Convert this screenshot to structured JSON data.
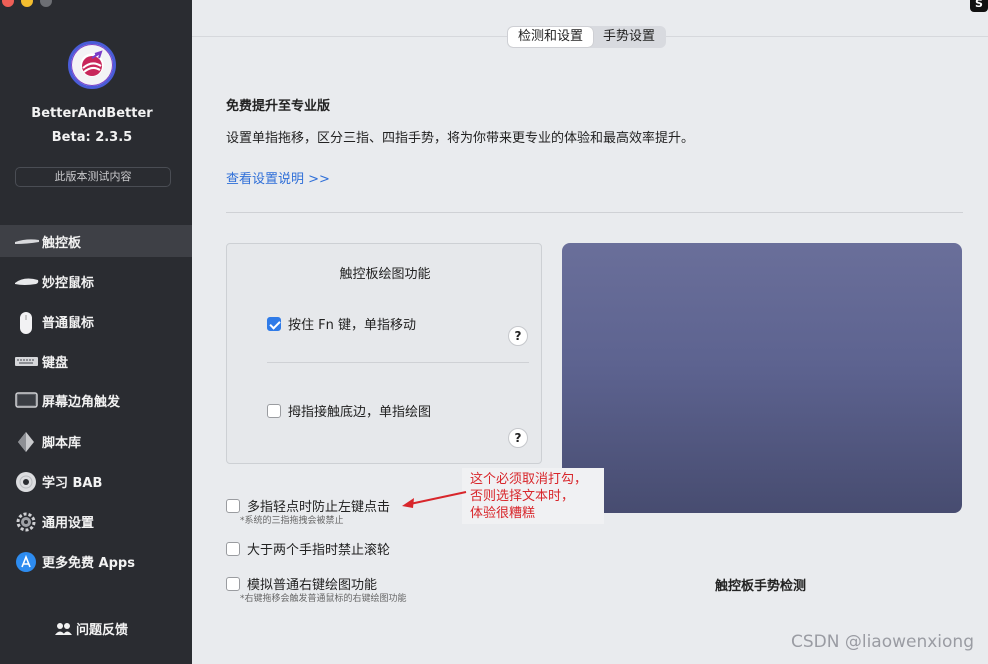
{
  "sidebar": {
    "app_name": "BetterAndBetter",
    "version": "Beta: 2.3.5",
    "test_button": "此版本测试内容",
    "items": [
      {
        "label": "触控板",
        "icon": "trackpad-icon",
        "active": true
      },
      {
        "label": "妙控鼠标",
        "icon": "magic-mouse-icon"
      },
      {
        "label": "普通鼠标",
        "icon": "mouse-icon"
      },
      {
        "label": "键盘",
        "icon": "keyboard-icon"
      },
      {
        "label": "屏幕边角触发",
        "icon": "screen-corner-icon"
      },
      {
        "label": "脚本库",
        "icon": "script-icon"
      },
      {
        "label": "学习 BAB",
        "icon": "disc-icon"
      },
      {
        "label": "通用设置",
        "icon": "gear-icon"
      },
      {
        "label": "更多免费 Apps",
        "icon": "app-store-icon"
      }
    ],
    "feedback": "问题反馈"
  },
  "tabs": {
    "detect": "检测和设置",
    "gesture": "手势设置"
  },
  "main": {
    "upgrade_title": "免费提升至专业版",
    "upgrade_desc": "设置单指拖移，区分三指、四指手势，将为你带来更专业的体验和最高效率提升。",
    "help_link": "查看设置说明 >>",
    "panel_title": "触控板绘图功能",
    "opt_fn": "按住 Fn 键，单指移动",
    "opt_thumb": "拇指接触底边，单指绘图",
    "opt_multi": "多指轻点时防止左键点击",
    "opt_multi_note": "*系统的三指拖拽会被禁止",
    "opt_scroll": "大于两个手指时禁止滚轮",
    "opt_right": "模拟普通右键绘图功能",
    "opt_right_note": "*右键拖移会触发普通鼠标的右键绘图功能",
    "preview_label": "触控板手势检测",
    "help_glyph": "?"
  },
  "annotation": {
    "line1": "这个必须取消打勾，",
    "line2": "否则选择文本时，",
    "line3": "体验很糟糕"
  },
  "watermark": "CSDN @liaowenxiong",
  "colors": {
    "sidebar_bg": "#2a2c31",
    "accent": "#2f7be8",
    "link": "#2f6fd8",
    "annotation": "#d8262b"
  }
}
